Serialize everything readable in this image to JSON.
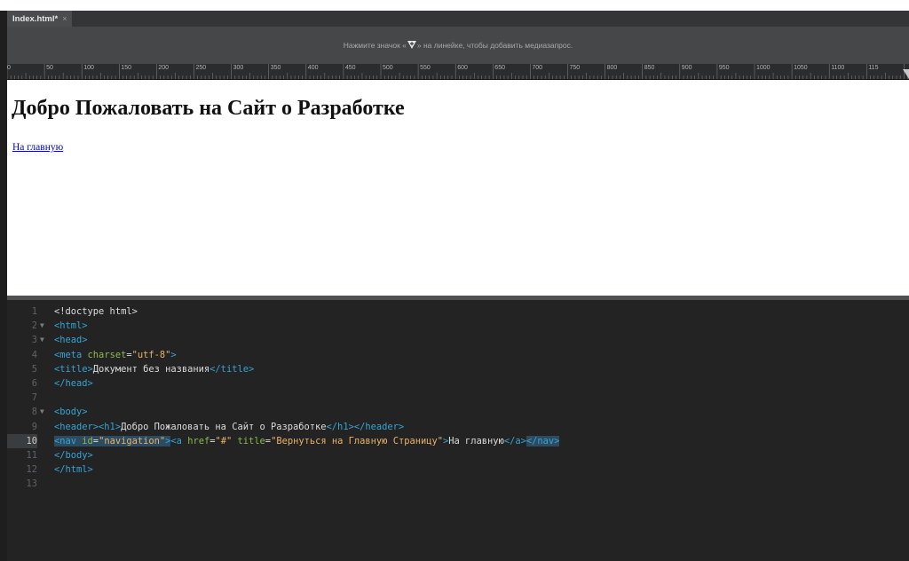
{
  "editor": {
    "tab": {
      "label": "Index.html*",
      "close": "×"
    },
    "media_query_hint": {
      "before": "Нажмите значок «",
      "after": "» на линейке, чтобы добавить медиазапрос."
    },
    "ruler_labels": [
      "0",
      "50",
      "100",
      "150",
      "200",
      "250",
      "300",
      "350",
      "400",
      "450",
      "500",
      "550",
      "600",
      "650",
      "700",
      "750",
      "800",
      "850",
      "900",
      "950",
      "1000",
      "1050",
      "1100",
      "115"
    ]
  },
  "design_view": {
    "heading": "Добро Пожаловать на Сайт о Разработке",
    "link": "На главную"
  },
  "code_view": {
    "line_numbers": [
      "1",
      "2",
      "3",
      "4",
      "5",
      "6",
      "7",
      "8",
      "9",
      "10",
      "11",
      "12",
      "13"
    ],
    "lines": [
      [
        {
          "t": "txt",
          "v": "<!doctype html>"
        }
      ],
      [
        {
          "t": "tag",
          "v": "<html>"
        }
      ],
      [
        {
          "t": "tag",
          "v": "<head>"
        }
      ],
      [
        {
          "t": "tag",
          "v": "<meta "
        },
        {
          "t": "attr",
          "v": "charset"
        },
        {
          "t": "txt",
          "v": "="
        },
        {
          "t": "val",
          "v": "\"utf-8\""
        },
        {
          "t": "tag",
          "v": ">"
        }
      ],
      [
        {
          "t": "tag",
          "v": "<title>"
        },
        {
          "t": "txt",
          "v": "Документ без названия"
        },
        {
          "t": "tag",
          "v": "</title>"
        }
      ],
      [
        {
          "t": "tag",
          "v": "</head>"
        }
      ],
      [],
      [
        {
          "t": "tag",
          "v": "<body>"
        }
      ],
      [
        {
          "t": "tag",
          "v": "<header><h1>"
        },
        {
          "t": "txt",
          "v": "Добро Пожаловать на Сайт о Разработке"
        },
        {
          "t": "tag",
          "v": "</h1></header>"
        }
      ],
      [
        {
          "t": "tag",
          "v": "<nav ",
          "s": 1
        },
        {
          "t": "attr",
          "v": "id",
          "s": 1
        },
        {
          "t": "txt",
          "v": "=",
          "s": 1
        },
        {
          "t": "val",
          "v": "\"navigation\"",
          "s": 1
        },
        {
          "t": "tag",
          "v": ">",
          "s": 1
        },
        {
          "t": "tag",
          "v": "<a "
        },
        {
          "t": "attr",
          "v": "href"
        },
        {
          "t": "txt",
          "v": "="
        },
        {
          "t": "val",
          "v": "\"#\" "
        },
        {
          "t": "attr",
          "v": "title"
        },
        {
          "t": "txt",
          "v": "="
        },
        {
          "t": "val",
          "v": "\"Вернуться на Главную Страницу\""
        },
        {
          "t": "tag",
          "v": ">"
        },
        {
          "t": "txt",
          "v": "На главную"
        },
        {
          "t": "tag",
          "v": "</a>"
        },
        {
          "t": "tag",
          "v": "</nav>",
          "s": 1
        }
      ],
      [
        {
          "t": "tag",
          "v": "</body>"
        }
      ],
      [
        {
          "t": "tag",
          "v": "</html>"
        }
      ],
      []
    ],
    "foldable_lines": [
      "2",
      "3",
      "8"
    ],
    "highlighted_line": "10"
  }
}
